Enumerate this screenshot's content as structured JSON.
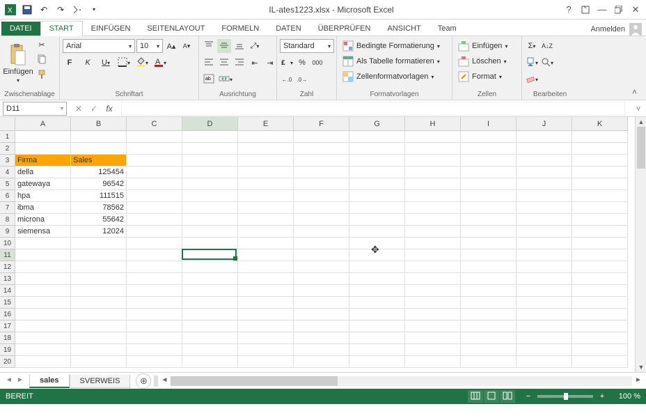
{
  "titlebar": {
    "title": "IL-ates1223.xlsx - Microsoft Excel"
  },
  "tabs": {
    "file": "DATEI",
    "items": [
      "START",
      "EINFÜGEN",
      "SEITENLAYOUT",
      "FORMELN",
      "DATEN",
      "ÜBERPRÜFEN",
      "ANSICHT",
      "Team"
    ],
    "active": "START",
    "login": "Anmelden"
  },
  "ribbon": {
    "clipboard": {
      "label": "Zwischenablage",
      "paste": "Einfügen"
    },
    "font": {
      "label": "Schriftart",
      "name": "Arial",
      "size": "10",
      "bold": "F",
      "italic": "K",
      "underline": "U"
    },
    "alignment": {
      "label": "Ausrichtung"
    },
    "number": {
      "label": "Zahl",
      "format": "Standard"
    },
    "styles": {
      "label": "Formatvorlagen",
      "cond": "Bedingte Formatierung",
      "table": "Als Tabelle formatieren",
      "cell": "Zellenformatvorlagen"
    },
    "cells": {
      "label": "Zellen",
      "insert": "Einfügen",
      "delete": "Löschen",
      "format": "Format"
    },
    "editing": {
      "label": "Bearbeiten"
    }
  },
  "formula": {
    "cell_ref": "D11",
    "formula": ""
  },
  "grid": {
    "columns": [
      "A",
      "B",
      "C",
      "D",
      "E",
      "F",
      "G",
      "H",
      "I",
      "J",
      "K"
    ],
    "row_count": 20,
    "selected": {
      "col": "D",
      "row": 11
    },
    "header_row": 3,
    "headers": {
      "A": "Firma",
      "B": "Sales"
    },
    "data": [
      {
        "row": 4,
        "A": "della",
        "B": "125454"
      },
      {
        "row": 5,
        "A": "gatewaya",
        "B": "96542"
      },
      {
        "row": 6,
        "A": "hpa",
        "B": "111515"
      },
      {
        "row": 7,
        "A": "ibma",
        "B": "78562"
      },
      {
        "row": 8,
        "A": "microna",
        "B": "55642"
      },
      {
        "row": 9,
        "A": "siemensa",
        "B": "12024"
      }
    ]
  },
  "sheets": {
    "tabs": [
      "sales",
      "SVERWEIS"
    ],
    "active": "sales"
  },
  "status": {
    "ready": "BEREIT",
    "zoom": "100 %"
  }
}
